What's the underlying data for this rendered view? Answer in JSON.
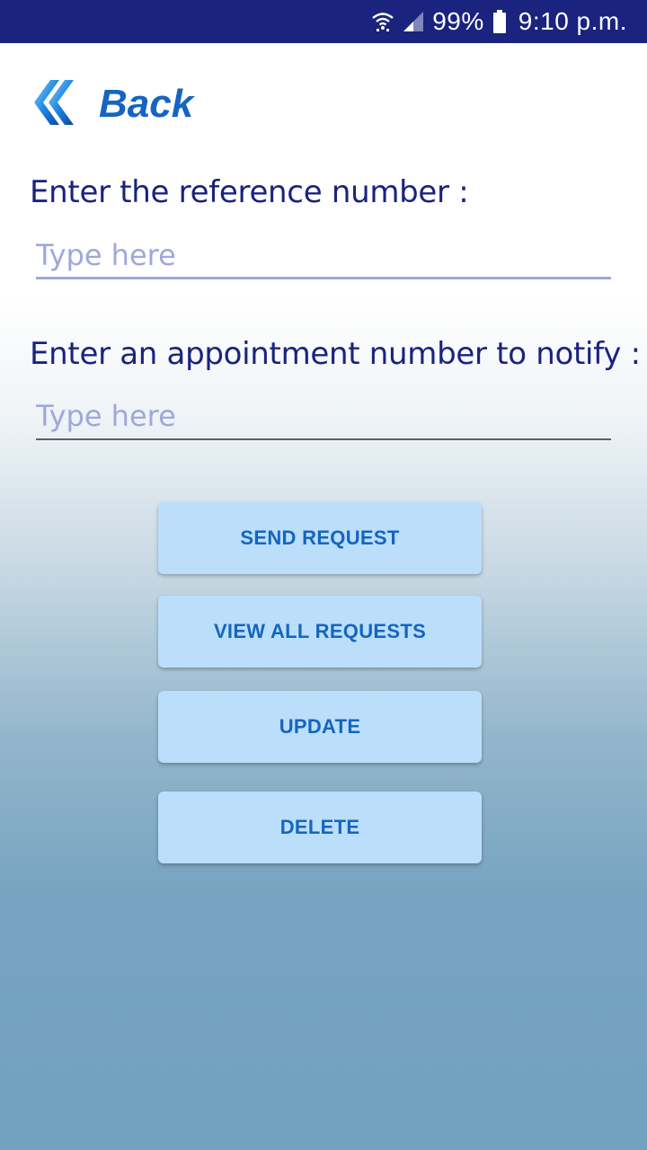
{
  "status_bar": {
    "battery": "99%",
    "time": "9:10 p.m.",
    "icons": [
      "wifi-icon",
      "signal-icon",
      "battery-icon"
    ]
  },
  "header": {
    "back_label": "Back",
    "back_icon": "double-chevron-left-icon"
  },
  "form": {
    "reference_label": "Enter the reference number :",
    "reference_placeholder": "Type here",
    "reference_value": "",
    "appointment_label": "Enter an appointment number to notify :",
    "appointment_placeholder": "Type here",
    "appointment_value": ""
  },
  "actions": {
    "send_request": "SEND REQUEST",
    "view_all_requests": "VIEW ALL REQUESTS",
    "update": "UPDATE",
    "delete": "DELETE"
  },
  "colors": {
    "status_bar": "#1a237e",
    "accent": "#1565c0",
    "button_bg": "#bbdefb",
    "label_text": "#1a237e",
    "placeholder": "#9fa8da"
  }
}
